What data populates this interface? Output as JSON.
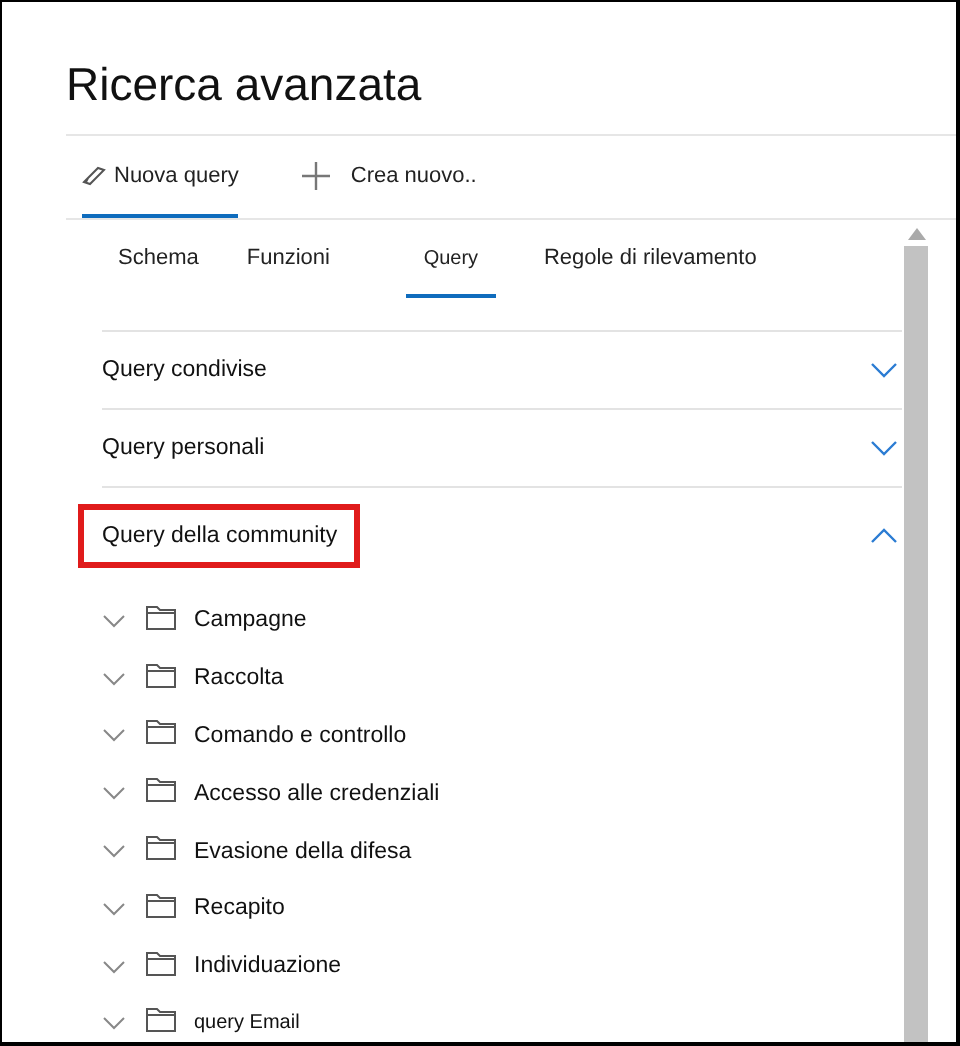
{
  "title": "Ricerca avanzata",
  "tabs": [
    {
      "label": "Nuova query",
      "kind": "edit",
      "selected": true
    },
    {
      "label": "Crea nuovo..",
      "kind": "add",
      "selected": false
    }
  ],
  "subtabs": [
    {
      "label": "Schema",
      "selected": false
    },
    {
      "label": "Funzioni",
      "selected": false
    },
    {
      "label": "Query",
      "selected": true
    },
    {
      "label": "Regole di rilevamento",
      "selected": false
    }
  ],
  "sections": [
    {
      "label": "Query condivise",
      "expanded": false,
      "highlighted": false
    },
    {
      "label": "Query personali",
      "expanded": false,
      "highlighted": false
    },
    {
      "label": "Query della community",
      "expanded": true,
      "highlighted": true
    }
  ],
  "folders": [
    {
      "label": "Campagne",
      "expanded": false
    },
    {
      "label": "Raccolta",
      "expanded": false
    },
    {
      "label": "Comando e controllo",
      "expanded": false
    },
    {
      "label": "Accesso alle credenziali",
      "expanded": false
    },
    {
      "label": "Evasione della difesa",
      "expanded": false
    },
    {
      "label": "Recapito",
      "expanded": false
    },
    {
      "label": "Individuazione",
      "expanded": false
    },
    {
      "label": "query Email",
      "expanded": false
    }
  ]
}
